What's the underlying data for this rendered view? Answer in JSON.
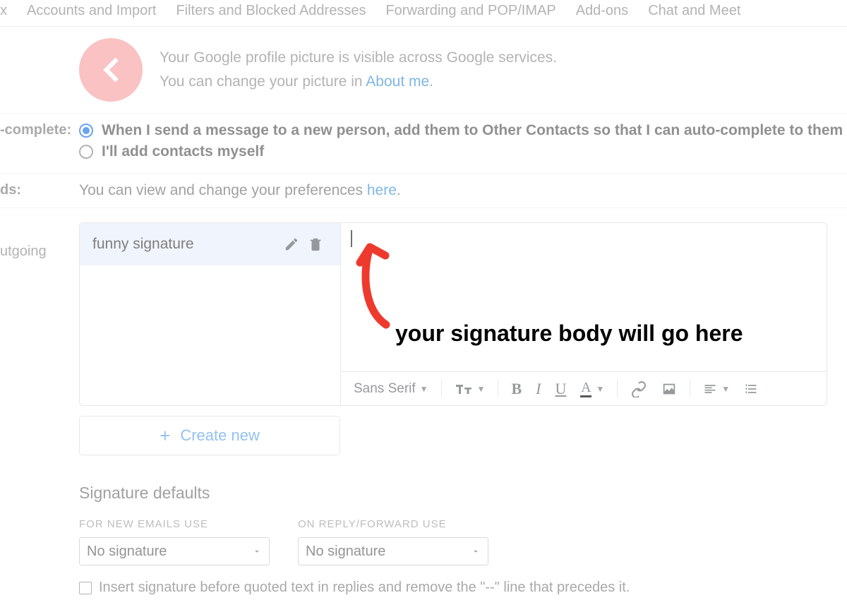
{
  "tabs": {
    "partial0": "x",
    "t1": "Accounts and Import",
    "t2": "Filters and Blocked Addresses",
    "t3": "Forwarding and POP/IMAP",
    "t4": "Add-ons",
    "t5": "Chat and Meet"
  },
  "profile": {
    "line1": "Your Google profile picture is visible across Google services.",
    "line2_prefix": "You can change your picture in ",
    "line2_link": "About me",
    "line2_suffix": "."
  },
  "autocomplete": {
    "label": "-complete:",
    "option1": "When I send a message to a new person, add them to Other Contacts so that I can auto-complete to them",
    "option2": "I'll add contacts myself"
  },
  "ads": {
    "label": "ds:",
    "text_prefix": "You can view and change your preferences ",
    "text_link": "here",
    "text_suffix": "."
  },
  "signature": {
    "left_label": "utgoing",
    "item_name": "funny signature",
    "font_label": "Sans Serif",
    "create_label": "Create new"
  },
  "defaults": {
    "heading": "Signature defaults",
    "new_label": "FOR NEW EMAILS USE",
    "reply_label": "ON REPLY/FORWARD USE",
    "new_value": "No signature",
    "reply_value": "No signature",
    "checkbox_label": "Insert signature before quoted text in replies and remove the \"--\" line that precedes it."
  },
  "annotation": {
    "text": "your signature body will go here"
  }
}
